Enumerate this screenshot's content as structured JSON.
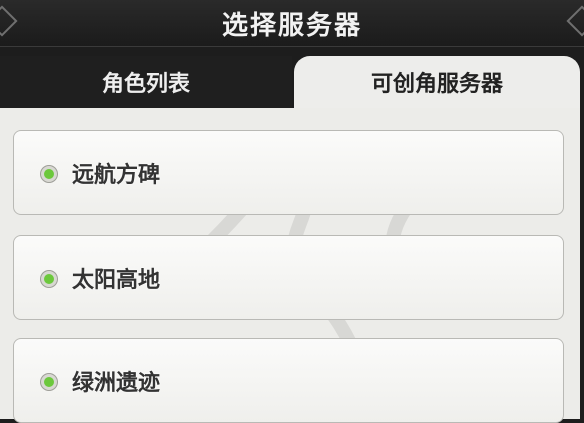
{
  "header": {
    "title": "选择服务器"
  },
  "tabs": [
    {
      "label": "角色列表",
      "active": false
    },
    {
      "label": "可创角服务器",
      "active": true
    }
  ],
  "servers": [
    {
      "name": "远航方碑",
      "status": "online"
    },
    {
      "name": "太阳高地",
      "status": "online"
    },
    {
      "name": "绿洲遗迹",
      "status": "online"
    }
  ],
  "colors": {
    "status_online": "#6cc83c",
    "panel_bg": "#ecece9",
    "header_bg": "#1d1d1d"
  }
}
